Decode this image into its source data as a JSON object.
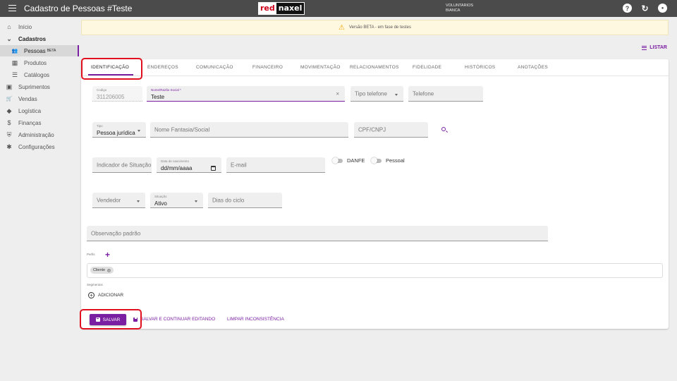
{
  "header": {
    "title": "Cadastro de Pessoas #Teste",
    "logo_red": "red",
    "logo_naxel": "naxel",
    "user_line1": "VOLUNTARIOS",
    "user_line2": "BIANCA",
    "help_glyph": "?",
    "refresh_glyph": "↻",
    "account_glyph": "●"
  },
  "sidebar": {
    "items": [
      {
        "label": "Início",
        "icon": "home-icon",
        "glyph": "⌂"
      },
      {
        "label": "Cadastros",
        "icon": "chevron-down-icon",
        "glyph": "⌄"
      },
      {
        "label": "Pessoas",
        "badge": "BETA",
        "icon": "people-icon",
        "glyph": "👥"
      },
      {
        "label": "Produtos",
        "icon": "products-icon",
        "glyph": "▦"
      },
      {
        "label": "Catálogos",
        "icon": "list-icon",
        "glyph": "☰"
      },
      {
        "label": "Suprimentos",
        "icon": "supplies-icon",
        "glyph": "▣"
      },
      {
        "label": "Vendas",
        "icon": "cart-icon",
        "glyph": "🛒"
      },
      {
        "label": "Logística",
        "icon": "logistics-icon",
        "glyph": "◆"
      },
      {
        "label": "Finanças",
        "icon": "money-icon",
        "glyph": "$"
      },
      {
        "label": "Administração",
        "icon": "shield-icon",
        "glyph": "⛨"
      },
      {
        "label": "Configurações",
        "icon": "gear-icon",
        "glyph": "✱"
      }
    ]
  },
  "banner": {
    "icon": "warning-icon",
    "glyph": "⚠",
    "text": "Versão BETA - em fase de testes"
  },
  "listar_label": "LISTAR",
  "tabs": [
    {
      "label": "IDENTIFICAÇÃO"
    },
    {
      "label": "ENDEREÇOS"
    },
    {
      "label": "COMUNICAÇÃO"
    },
    {
      "label": "FINANCEIRO"
    },
    {
      "label": "MOVIMENTAÇÃO"
    },
    {
      "label": "RELACIONAMENTOS"
    },
    {
      "label": "FIDELIDADE"
    },
    {
      "label": "HISTÓRICOS"
    },
    {
      "label": "ANOTAÇÕES"
    }
  ],
  "form": {
    "codigo": {
      "label": "Codigo",
      "value": "311206005"
    },
    "nome": {
      "label": "Nome/Razão Social *",
      "value": "Teste",
      "clear_glyph": "×"
    },
    "tipo_telefone": {
      "placeholder": "Tipo telefone"
    },
    "telefone": {
      "placeholder": "Telefone"
    },
    "tipo": {
      "label": "Tipo",
      "value": "Pessoa jurídica"
    },
    "nome_fantasia": {
      "placeholder": "Nome Fantasia/Social"
    },
    "cpf_cnpj": {
      "placeholder": "CPF/CNPJ"
    },
    "indicador_ie": {
      "placeholder": "Indicador de Situação IE"
    },
    "data_nascimento": {
      "label": "Data de nascimento",
      "value": "dd/mm/aaaa"
    },
    "email": {
      "placeholder": "E-mail"
    },
    "danfe_label": "DANFE",
    "pessoal_label": "Pessoal",
    "vendedor": {
      "placeholder": "Vendedor"
    },
    "situacao": {
      "label": "Situação",
      "value": "Ativo"
    },
    "dias_ciclo": {
      "placeholder": "Dias do ciclo"
    },
    "observacao": {
      "placeholder": "Observação padrão"
    },
    "perfis_label": "Perfis",
    "plus_glyph": "+",
    "perfis_chips": [
      "Cliente"
    ],
    "chip_remove_glyph": "×",
    "segmentos_label": "Segmentos",
    "add_glyph": "+",
    "adicionar_label": "ADICIONAR"
  },
  "actions": {
    "save_label": "SALVAR",
    "save_continue_label": "SALVAR E CONTINUAR EDITANDO",
    "clear_label": "LIMPAR INCONSISTÊNCIA"
  },
  "colors": {
    "accent": "#7b1fa2",
    "highlight": "#e0101f",
    "topbar": "#4b4b4b"
  }
}
